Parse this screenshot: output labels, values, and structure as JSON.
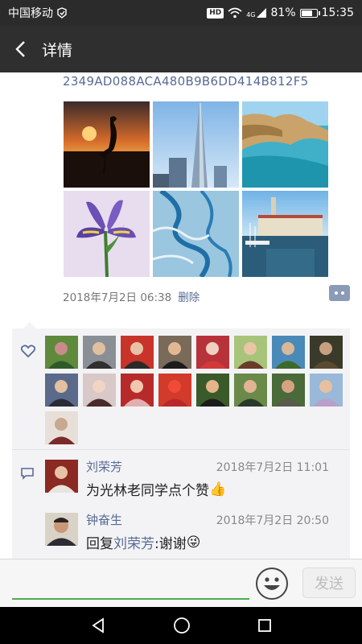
{
  "status_bar": {
    "carrier": "中国移动",
    "hd": "HD",
    "network": "4G",
    "battery": "81%",
    "battery_level": 0.81,
    "time": "15:35"
  },
  "header": {
    "title": "详情"
  },
  "post": {
    "hash_text": "2349AD088ACA480B9B6DD414B812F5",
    "date": "2018年7月2日 06:38",
    "delete_label": "删除"
  },
  "likes": {
    "count": 17
  },
  "comments": [
    {
      "author": "刘荣芳",
      "time": "2018年7月2日 11:01",
      "text": "为光林老同学点个赞",
      "emoji": "👍"
    },
    {
      "author": "钟奋生",
      "time": "2018年7月2日 20:50",
      "reply_prefix": "回复",
      "reply_to": "刘荣芳",
      "text": ":谢谢",
      "emoji": "😜"
    }
  ],
  "input": {
    "placeholder": "",
    "send_label": "发送"
  },
  "colors": {
    "link": "#576b95",
    "accent_green": "#4cae4c",
    "header_bg": "#2f2f2f"
  }
}
